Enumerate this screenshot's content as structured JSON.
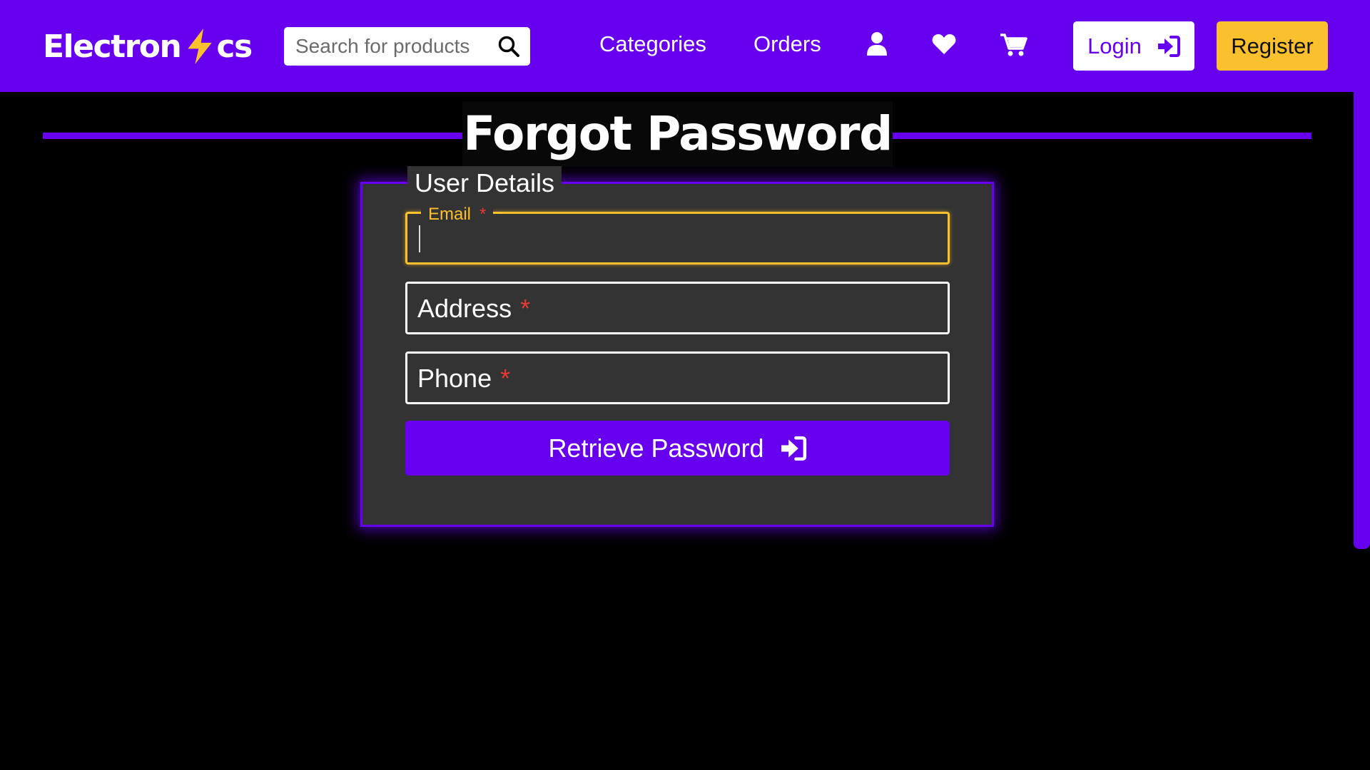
{
  "navbar": {
    "logo": {
      "before": "Electron",
      "after": "cs",
      "bolt_icon": "lightning-bolt-icon",
      "bolt_color": "#fbc02d"
    },
    "search": {
      "placeholder": "Search for products",
      "icon": "search-icon"
    },
    "links": {
      "categories": "Categories",
      "orders": "Orders"
    },
    "icons": [
      "user-icon",
      "heart-icon",
      "cart-icon"
    ],
    "login_label": "Login",
    "register_label": "Register"
  },
  "page": {
    "title": "Forgot Password"
  },
  "form": {
    "legend": "User Details",
    "fields": {
      "email": {
        "label": "Email",
        "required_mark": "*",
        "value": "",
        "focused": true
      },
      "address": {
        "label": "Address",
        "required_mark": "*",
        "value": ""
      },
      "phone": {
        "label": "Phone",
        "required_mark": "*",
        "value": ""
      }
    },
    "submit_label": "Retrieve Password",
    "submit_icon": "sign-in-icon"
  },
  "colors": {
    "primary": "#6600ee",
    "accent": "#fbc02d",
    "required": "#e53935",
    "panel": "#333333",
    "background": "#000000"
  }
}
